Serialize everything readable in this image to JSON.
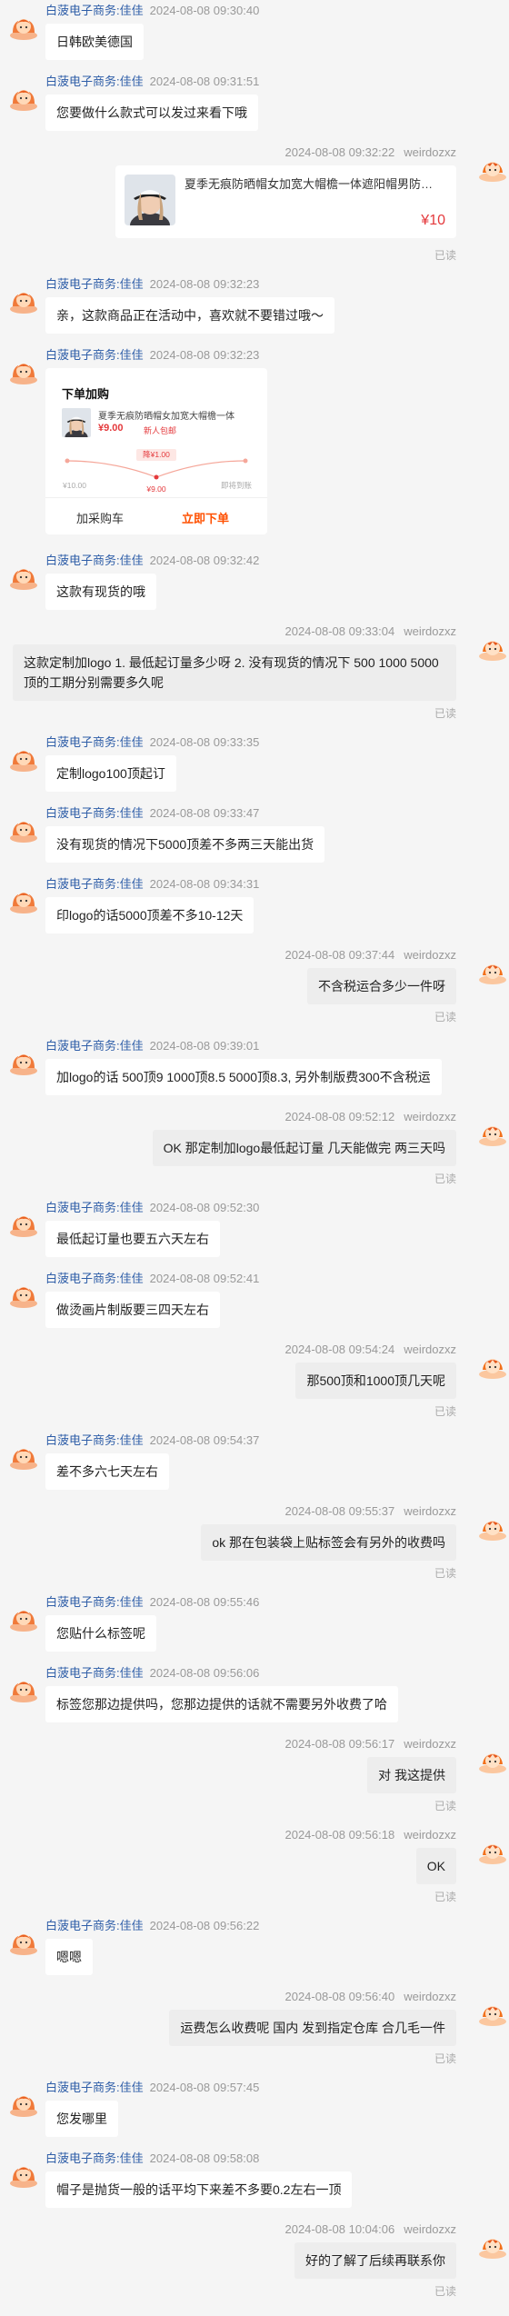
{
  "seller_name": "白菠电子商务:佳佳",
  "buyer_name": "weirdozxz",
  "read_label": "已读",
  "product_card": {
    "title": "夏季无痕防晒帽女加宽大帽檐一体遮阳帽男防紫外线U...",
    "price": "¥10"
  },
  "order_card": {
    "title": "下单加购",
    "product_name": "夏季无痕防晒帽女加宽大帽檐一体",
    "price": "¥9.00",
    "tag": "新人包邮",
    "points": [
      {
        "label": "¥10.00"
      },
      {
        "label": "降¥1.00"
      },
      {
        "label": "¥9.00"
      },
      {
        "label": "即将到账"
      }
    ],
    "add_cart": "加采购车",
    "buy_now": "立即下单"
  },
  "messages": [
    {
      "side": "left",
      "time": "2024-08-08 09:30:40",
      "text": "日韩欧美德国"
    },
    {
      "side": "left",
      "time": "2024-08-08 09:31:51",
      "text": "您要做什么款式可以发过来看下哦"
    },
    {
      "side": "right",
      "time": "2024-08-08 09:32:22",
      "type": "product"
    },
    {
      "side": "left",
      "time": "2024-08-08 09:32:23",
      "text": "亲，这款商品正在活动中，喜欢就不要错过哦～"
    },
    {
      "side": "left",
      "time": "2024-08-08 09:32:23",
      "type": "order"
    },
    {
      "side": "left",
      "time": "2024-08-08 09:32:42",
      "text": "这款有现货的哦"
    },
    {
      "side": "right",
      "time": "2024-08-08 09:33:04",
      "text": "这款定制加logo 1. 最低起订量多少呀  2. 没有现货的情况下 500 1000 5000顶的工期分别需要多久呢",
      "wide": true
    },
    {
      "side": "left",
      "time": "2024-08-08 09:33:35",
      "text": "定制logo100顶起订"
    },
    {
      "side": "left",
      "time": "2024-08-08 09:33:47",
      "text": "没有现货的情况下5000顶差不多两三天能出货"
    },
    {
      "side": "left",
      "time": "2024-08-08 09:34:31",
      "text": "印logo的话5000顶差不多10-12天"
    },
    {
      "side": "right",
      "time": "2024-08-08 09:37:44",
      "text": "不含税运合多少一件呀"
    },
    {
      "side": "left",
      "time": "2024-08-08 09:39:01",
      "text": "加logo的话  500顶9  1000顶8.5  5000顶8.3, 另外制版费300不含税运"
    },
    {
      "side": "right",
      "time": "2024-08-08 09:52:12",
      "text": "OK 那定制加logo最低起订量 几天能做完 两三天吗"
    },
    {
      "side": "left",
      "time": "2024-08-08 09:52:30",
      "text": "最低起订量也要五六天左右"
    },
    {
      "side": "left",
      "time": "2024-08-08 09:52:41",
      "text": "做烫画片制版要三四天左右"
    },
    {
      "side": "right",
      "time": "2024-08-08 09:54:24",
      "text": "那500顶和1000顶几天呢"
    },
    {
      "side": "left",
      "time": "2024-08-08 09:54:37",
      "text": "差不多六七天左右"
    },
    {
      "side": "right",
      "time": "2024-08-08 09:55:37",
      "text": "ok 那在包装袋上贴标签会有另外的收费吗"
    },
    {
      "side": "left",
      "time": "2024-08-08 09:55:46",
      "text": "您贴什么标签呢"
    },
    {
      "side": "left",
      "time": "2024-08-08 09:56:06",
      "text": "标签您那边提供吗，您那边提供的话就不需要另外收费了哈"
    },
    {
      "side": "right",
      "time": "2024-08-08 09:56:17",
      "text": "对 我这提供"
    },
    {
      "side": "right",
      "time": "2024-08-08 09:56:18",
      "text": "OK"
    },
    {
      "side": "left",
      "time": "2024-08-08 09:56:22",
      "text": "嗯嗯"
    },
    {
      "side": "right",
      "time": "2024-08-08 09:56:40",
      "text": "运费怎么收费呢 国内 发到指定仓库 合几毛一件"
    },
    {
      "side": "left",
      "time": "2024-08-08 09:57:45",
      "text": "您发哪里"
    },
    {
      "side": "left",
      "time": "2024-08-08 09:58:08",
      "text": "帽子是抛货一般的话平均下来差不多要0.2左右一顶"
    },
    {
      "side": "right",
      "time": "2024-08-08 10:04:06",
      "text": "好的了解了后续再联系你"
    }
  ]
}
